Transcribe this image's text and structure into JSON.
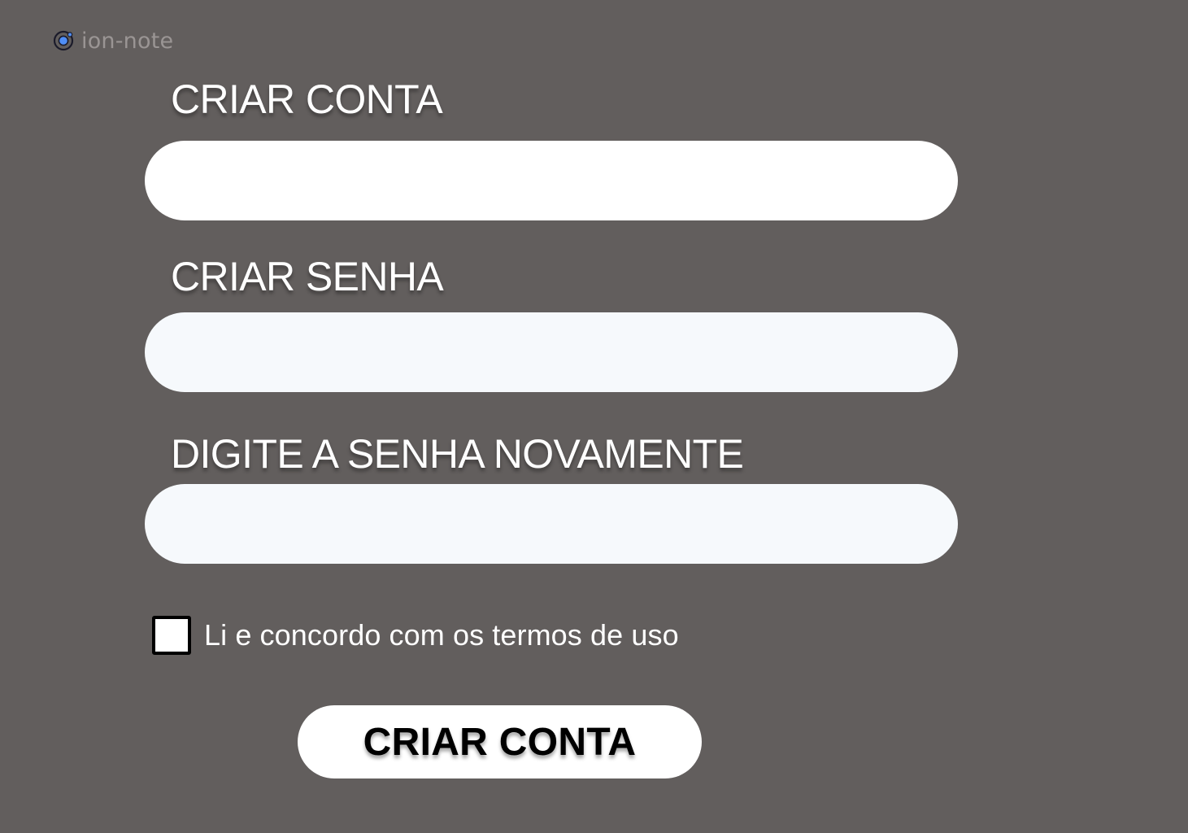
{
  "app": {
    "name": "ion-note",
    "icon": "ionic-logo-icon"
  },
  "form": {
    "account_label": "CRIAR CONTA",
    "account_value": "",
    "password_label": "CRIAR SENHA",
    "password_value": "",
    "password_confirm_label": "DIGITE A SENHA NOVAMENTE",
    "password_confirm_value": "",
    "terms_checked": false,
    "terms_label": "Li e concordo com os termos de uso",
    "submit_label": "CRIAR CONTA"
  },
  "colors": {
    "background": "#625e5d",
    "input_primary": "#ffffff",
    "input_secondary": "#f6f9fc",
    "logo_accent": "#4f8ef7",
    "text": "#ffffff"
  }
}
